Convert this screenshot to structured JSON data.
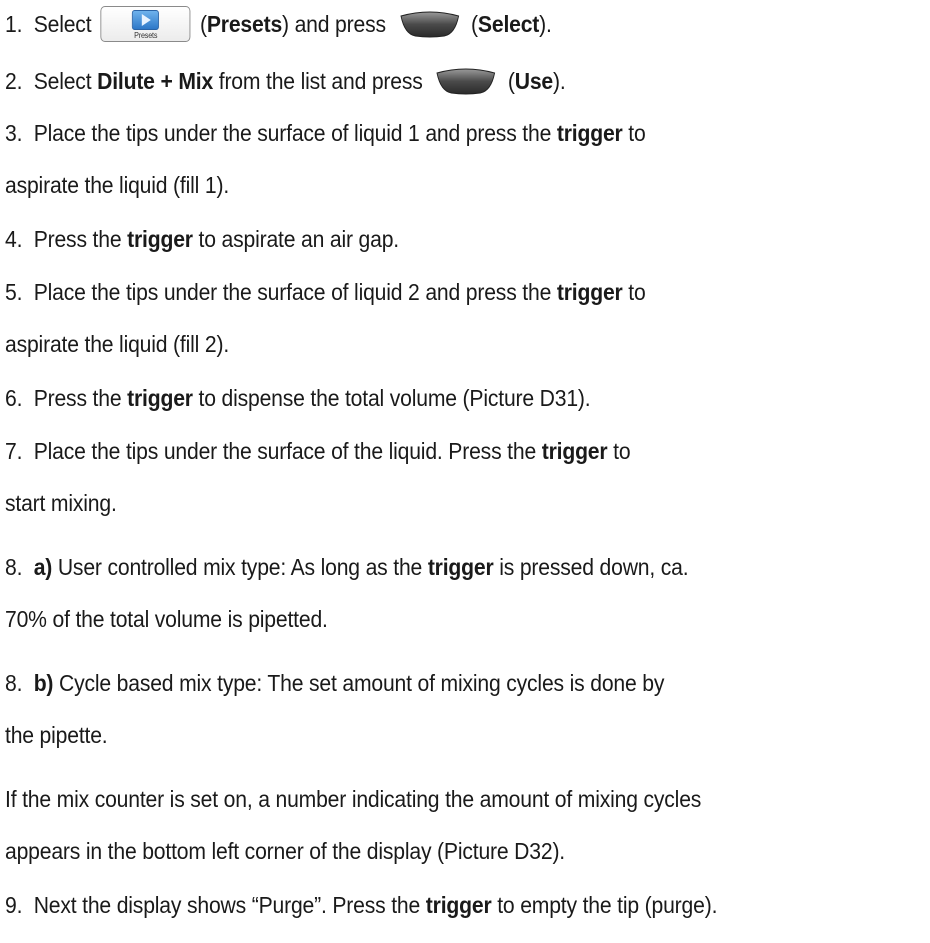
{
  "steps": {
    "s1": {
      "num": "1.",
      "t1": "Select ",
      "icon_caption": "Presets",
      "t2": " (",
      "b1": "Presets",
      "t3": ") and press ",
      "t4": " (",
      "b2": "Select",
      "t5": ")."
    },
    "s2": {
      "num": "2.",
      "t1": "Select ",
      "b1": "Dilute + Mix",
      "t2": " from the list and press ",
      "t3": " (",
      "b2": "Use",
      "t4": ")."
    },
    "s3": {
      "num": "3.",
      "t1": "Place the tips under the surface of liquid 1 and press the ",
      "b1": "trigger",
      "t2": " to",
      "t3": "aspirate the liquid (fill 1)."
    },
    "s4": {
      "num": "4.",
      "t1": "Press the ",
      "b1": "trigger",
      "t2": " to aspirate an air gap."
    },
    "s5": {
      "num": "5.",
      "t1": "Place the tips under the surface of liquid 2 and press the ",
      "b1": "trigger",
      "t2": " to",
      "t3": "aspirate the liquid (fill 2)."
    },
    "s6": {
      "num": "6.",
      "t1": "Press the ",
      "b1": "trigger",
      "t2": " to dispense the total volume (Picture D31)."
    },
    "s7": {
      "num": "7.",
      "t1": "Place the tips under the surface of the liquid. Press the ",
      "b1": "trigger",
      "t2": " to",
      "t3": "start mixing."
    },
    "s8a": {
      "num": "8.",
      "b0": "a)",
      "t1": " User controlled mix type: As long as the ",
      "b1": "trigger",
      "t2": " is pressed down, ca.",
      "t3": "70% of the total volume is pipetted."
    },
    "s8b": {
      "num": "8.",
      "b0": "b)",
      "t1": " Cycle based mix type: The set amount of mixing cycles is done by",
      "t2": "the pipette."
    },
    "note": {
      "t1": "If the mix counter is set on, a number indicating the amount of mixing cycles",
      "t2": "appears in the bottom left corner of the display (Picture D32)."
    },
    "s9": {
      "num": "9.",
      "t1": "Next the display shows “Purge”. Press the ",
      "b1": "trigger",
      "t2": " to empty the tip (purge)."
    }
  },
  "icons": [
    "presets-icon",
    "softkey-icon"
  ]
}
